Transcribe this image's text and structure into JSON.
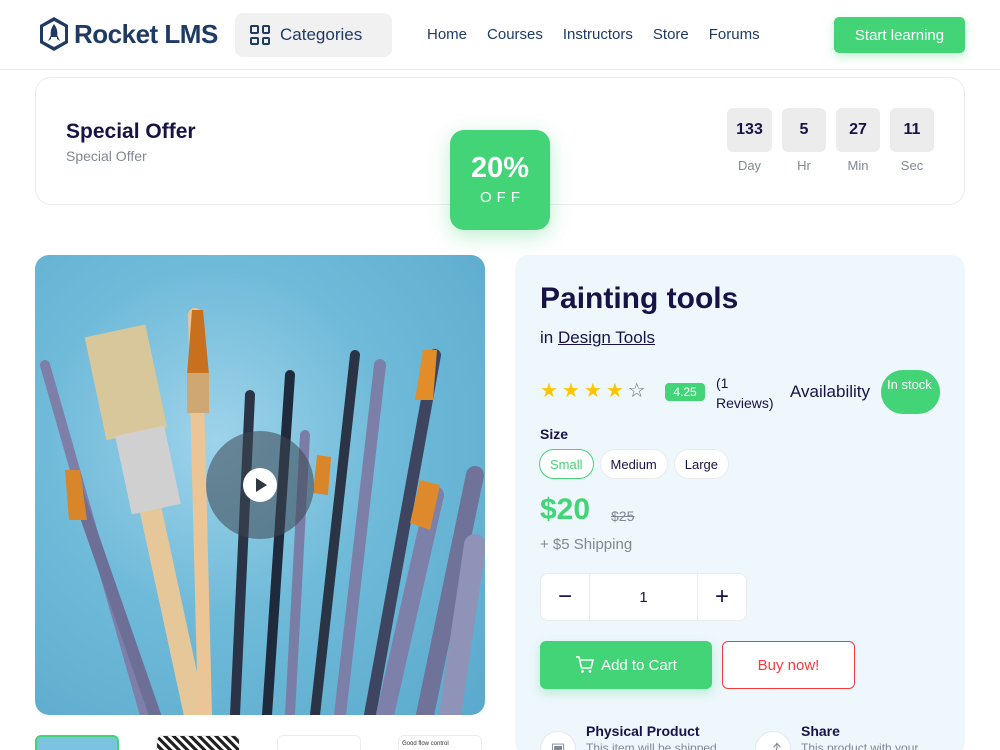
{
  "header": {
    "logo_text": "Rocket LMS",
    "categories_label": "Categories",
    "nav": [
      "Home",
      "Courses",
      "Instructors",
      "Store",
      "Forums"
    ],
    "start_button": "Start learning"
  },
  "offer": {
    "title": "Special Offer",
    "subtitle": "Special Offer",
    "discount_percent": "20%",
    "discount_suffix": "OFF",
    "timer": [
      {
        "value": "133",
        "label": "Day"
      },
      {
        "value": "5",
        "label": "Hr"
      },
      {
        "value": "27",
        "label": "Min"
      },
      {
        "value": "11",
        "label": "Sec"
      }
    ]
  },
  "product": {
    "title": "Painting tools",
    "category_prefix": "in",
    "category": "Design Tools",
    "rating": 4,
    "rating_value": "4.25",
    "reviews": "(1 Reviews)",
    "availability_label": "Availability",
    "availability_status": "In stock",
    "size_label": "Size",
    "sizes": [
      "Small",
      "Medium",
      "Large"
    ],
    "selected_size": "Small",
    "price": "$20",
    "old_price": "$25",
    "shipping": "+ $5 Shipping",
    "quantity": "1",
    "add_to_cart": "Add to Cart",
    "buy_now": "Buy now!",
    "features": [
      {
        "title": "Physical Product",
        "desc": "This item will be shipped"
      },
      {
        "title": "Share",
        "desc": "This product with your"
      }
    ],
    "thumb_text": "Good flow control"
  },
  "colors": {
    "accent": "#43d477",
    "danger": "#f63c3c",
    "primary_text": "#171347",
    "muted": "#818894",
    "panel_bg": "#edf7fc"
  }
}
